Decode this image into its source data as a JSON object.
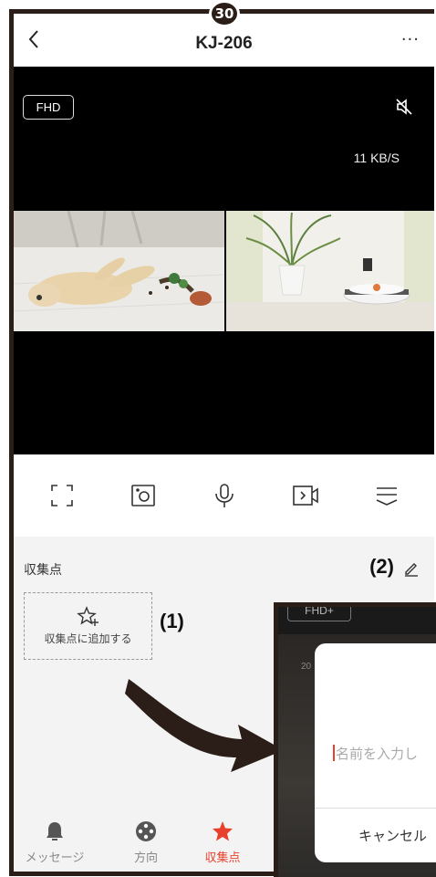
{
  "page_badge": "30",
  "header": {
    "title": "KJ-206",
    "back_icon": "chevron-left-icon",
    "more_label": "···"
  },
  "video": {
    "quality_label": "FHD",
    "rate": "11 KB/S"
  },
  "toolbar": [
    "fullscreen-icon",
    "screenshot-icon",
    "microphone-icon",
    "record-icon",
    "menu-icon"
  ],
  "section": {
    "title": "収集点",
    "add_label": "収集点に追加する",
    "annotation_1": "(1)",
    "annotation_2": "(2)"
  },
  "nav": {
    "items": [
      {
        "label": "メッセージ",
        "icon": "bell-icon",
        "active": false
      },
      {
        "label": "方向",
        "icon": "dpad-icon",
        "active": false
      },
      {
        "label": "収集点",
        "icon": "star-icon",
        "active": true
      }
    ],
    "active_color": "#e8412b"
  },
  "inset": {
    "quality_label": "FHD+",
    "partial_number": "20",
    "input_placeholder": "名前を入力し",
    "cancel_label": "キャンセル"
  }
}
